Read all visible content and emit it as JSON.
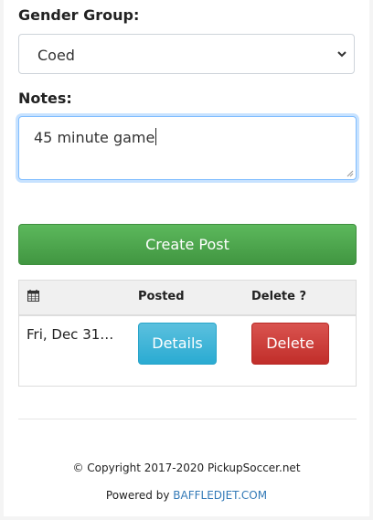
{
  "form": {
    "gender_group_label": "Gender Group:",
    "gender_group_value": "Coed",
    "notes_label": "Notes:",
    "notes_value": "45 minute game",
    "create_button_label": "Create Post"
  },
  "posts_table": {
    "headers": {
      "date_icon": "calendar-icon",
      "posted": "Posted",
      "delete": "Delete ?"
    },
    "rows": [
      {
        "date": "Fri, Dec 31…",
        "details_label": "Details",
        "delete_label": "Delete"
      }
    ]
  },
  "footer": {
    "copyright": "© Copyright 2017-2020 PickupSoccer.net",
    "powered_prefix": "Powered by",
    "powered_link": "BAFFLEDJET.COM"
  },
  "colors": {
    "create_button": "#4cae4c",
    "details_button": "#46b8da",
    "delete_button": "#d43f3a",
    "link": "#337ab7"
  }
}
